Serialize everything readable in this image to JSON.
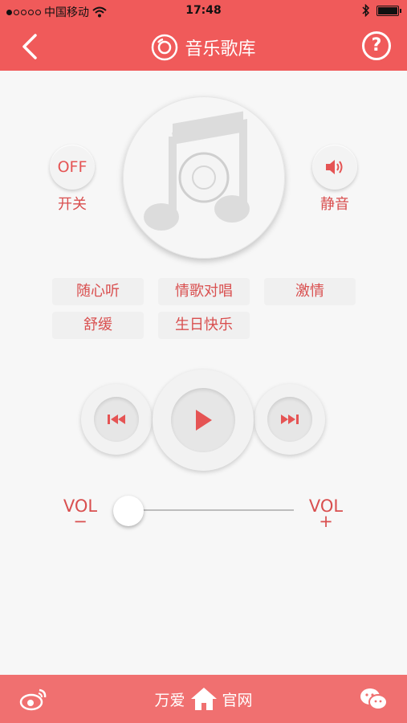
{
  "status_bar": {
    "carrier": "中国移动",
    "time": "17:48",
    "signal_bars_filled": 1,
    "signal_bars_total": 5,
    "battery_level": 1.0
  },
  "nav": {
    "title": "音乐歌库",
    "back_icon": "chevron-left-icon",
    "title_icon": "disc-icon",
    "help_label": "?"
  },
  "player": {
    "power": {
      "button_label": "OFF",
      "label": "开关"
    },
    "mute": {
      "icon": "speaker-icon",
      "label": "静音"
    },
    "disc_icon": "music-note-icon"
  },
  "tags": [
    "随心听",
    "情歌对唱",
    "激情",
    "舒缓",
    "生日快乐"
  ],
  "controls": {
    "prev_icon": "rewind-icon",
    "play_icon": "play-icon",
    "next_icon": "fast-forward-icon"
  },
  "volume": {
    "min_label": "VOL",
    "min_sign": "−",
    "max_label": "VOL",
    "max_sign": "+",
    "level": 0.0
  },
  "bottom": {
    "left_icon": "weibo-icon",
    "home_left": "万爱",
    "home_icon": "home-icon",
    "home_right": "官网",
    "right_icon": "wechat-icon"
  },
  "colors": {
    "accent": "#f05a5a",
    "accent_text": "#d94f4f",
    "bottom_bar": "#f07070",
    "background": "#f7f7f7"
  }
}
